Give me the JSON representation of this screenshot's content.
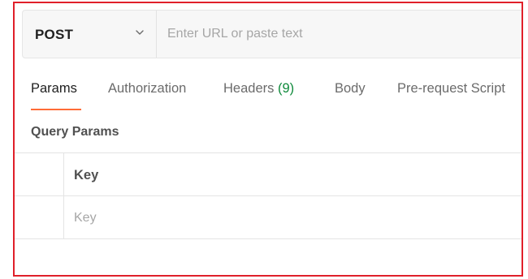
{
  "request": {
    "method": "POST",
    "url_value": "",
    "url_placeholder": "Enter URL or paste text"
  },
  "tabs": [
    {
      "label": "Params",
      "active": true
    },
    {
      "label": "Authorization",
      "active": false
    },
    {
      "label": "Headers",
      "count": "(9)",
      "active": false
    },
    {
      "label": "Body",
      "active": false
    },
    {
      "label": "Pre-request Script",
      "active": false
    }
  ],
  "query_params": {
    "title": "Query Params",
    "columns": [
      "Key"
    ],
    "new_row": {
      "key_value": "",
      "key_placeholder": "Key"
    }
  },
  "colors": {
    "frame_border": "#e0202a",
    "active_tab_underline": "#ff6c37",
    "headers_count": "#0f8a3b"
  },
  "icons": {
    "method_dropdown": "chevron-down-icon"
  }
}
